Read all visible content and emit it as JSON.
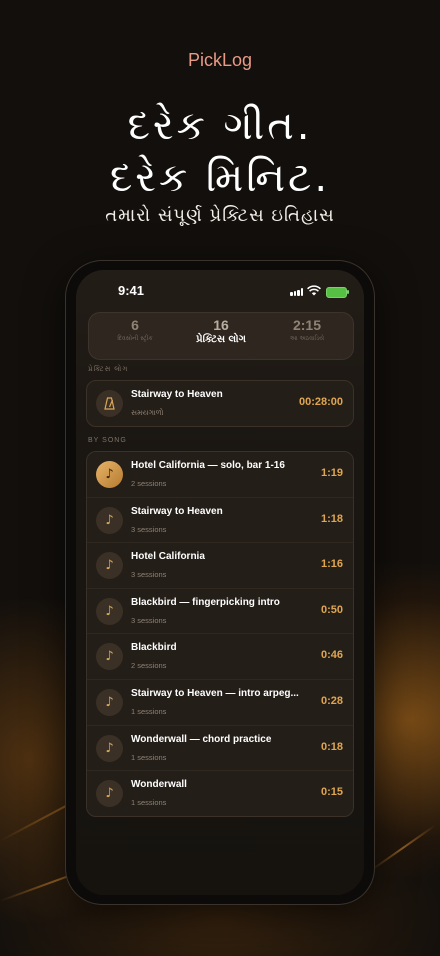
{
  "brand": "PickLog",
  "headline": {
    "line1": "દરેક ગીત.",
    "line2": "દરેક મિનિટ."
  },
  "subheadline": "તમારો સંપૂર્ણ પ્રેક્ટિસ ઇતિહાસ",
  "status_bar": {
    "time": "9:41"
  },
  "stats": [
    {
      "value": "6",
      "label": "દિવસોની સ્ટ્રીક",
      "active": false
    },
    {
      "value": "16",
      "label": "પ્રેક્ટિસ લોગ",
      "active": true
    },
    {
      "value": "2:15",
      "label": "આ અઠવાડિયે",
      "active": false
    }
  ],
  "practice_log_section": {
    "title": "પ્રેક્ટિસ લોગ",
    "item": {
      "title": "Stairway to Heaven",
      "subtitle": "સમયગાળો",
      "duration": "00:28:00",
      "icon": "metronome-icon"
    }
  },
  "by_song_section": {
    "title": "BY SONG",
    "songs": [
      {
        "title": "Hotel California — solo, bar 1-16",
        "sessions": "2 sessions",
        "duration": "1:19",
        "icon": "music-note-icon"
      },
      {
        "title": "Stairway to Heaven",
        "sessions": "3 sessions",
        "duration": "1:18",
        "icon": "music-note-icon"
      },
      {
        "title": "Hotel California",
        "sessions": "3 sessions",
        "duration": "1:16",
        "icon": "music-note-icon"
      },
      {
        "title": "Blackbird — fingerpicking intro",
        "sessions": "3 sessions",
        "duration": "0:50",
        "icon": "music-note-icon"
      },
      {
        "title": "Blackbird",
        "sessions": "2 sessions",
        "duration": "0:46",
        "icon": "music-note-icon"
      },
      {
        "title": "Stairway to Heaven — intro arpeg...",
        "sessions": "1 sessions",
        "duration": "0:28",
        "icon": "music-note-icon"
      },
      {
        "title": "Wonderwall — chord practice",
        "sessions": "1 sessions",
        "duration": "0:18",
        "icon": "music-note-icon"
      },
      {
        "title": "Wonderwall",
        "sessions": "1 sessions",
        "duration": "0:15",
        "icon": "music-note-icon"
      }
    ]
  },
  "colors": {
    "accent": "#e0a64f",
    "brand": "#e89a86",
    "background": "#120f0c"
  }
}
